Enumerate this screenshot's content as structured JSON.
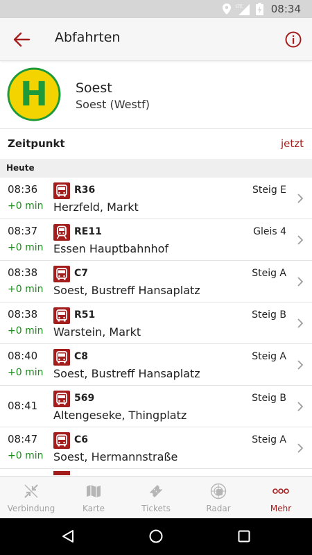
{
  "status_bar": {
    "time": "08:34",
    "network_label": "LTE"
  },
  "app_bar": {
    "title": "Abfahrten",
    "back_icon": "arrow-left-icon",
    "info_icon": "info-circle-icon"
  },
  "station": {
    "name": "Soest",
    "subtitle": "Soest (Westf)",
    "sign_letter": "H"
  },
  "time_selector": {
    "label": "Zeitpunkt",
    "value": "jetzt"
  },
  "day_header": "Heute",
  "departures": [
    {
      "time": "08:36",
      "delay": "+0 min",
      "vehicle": "bus",
      "line": "R36",
      "platform": "Steig E",
      "destination": "Herzfeld, Markt"
    },
    {
      "time": "08:37",
      "delay": "+0 min",
      "vehicle": "train",
      "line": "RE11",
      "platform": "Gleis 4",
      "destination": "Essen Hauptbahnhof"
    },
    {
      "time": "08:38",
      "delay": "+0 min",
      "vehicle": "bus",
      "line": "C7",
      "platform": "Steig A",
      "destination": "Soest, Bustreff Hansaplatz"
    },
    {
      "time": "08:38",
      "delay": "+0 min",
      "vehicle": "bus",
      "line": "R51",
      "platform": "Steig B",
      "destination": "Warstein, Markt"
    },
    {
      "time": "08:40",
      "delay": "+0 min",
      "vehicle": "bus",
      "line": "C8",
      "platform": "Steig A",
      "destination": "Soest, Bustreff Hansaplatz"
    },
    {
      "time": "08:41",
      "delay": "",
      "vehicle": "bus",
      "line": "569",
      "platform": "Steig B",
      "destination": "Altengeseke, Thingplatz"
    },
    {
      "time": "08:47",
      "delay": "+0 min",
      "vehicle": "bus",
      "line": "C6",
      "platform": "Steig A",
      "destination": "Soest, Hermannstraße"
    }
  ],
  "bottom_nav": [
    {
      "label": "Verbindung",
      "icon": "route-arrows-icon",
      "active": false
    },
    {
      "label": "Karte",
      "icon": "map-icon",
      "active": false
    },
    {
      "label": "Tickets",
      "icon": "ticket-icon",
      "active": false
    },
    {
      "label": "Radar",
      "icon": "radar-icon",
      "active": false
    },
    {
      "label": "Mehr",
      "icon": "more-dots-icon",
      "active": true
    }
  ],
  "colors": {
    "accent": "#a31d1d",
    "on_time": "#1a8a1a",
    "sign_yellow": "#f4d400",
    "sign_green": "#1f9a3a"
  }
}
